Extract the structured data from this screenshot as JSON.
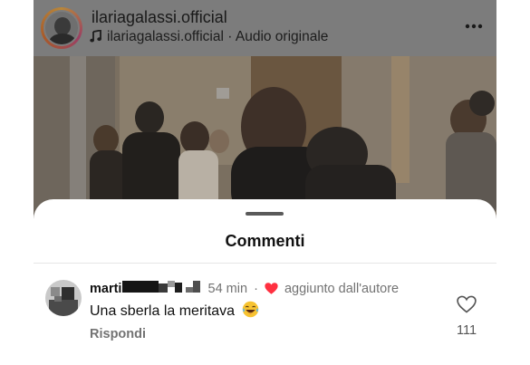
{
  "post": {
    "username": "ilariagalassi.official",
    "audio_text": "ilariagalassi.official · Audio originale",
    "more_icon": "more-horizontal-icon",
    "music_icon": "music-note-icon"
  },
  "comments_sheet": {
    "title": "Commenti",
    "comment": {
      "user": "marti",
      "time": "54 min",
      "separator": "·",
      "author_badge": "aggiunto dall'autore",
      "text": "Una sberla la meritava",
      "emoji": "😂",
      "reply_label": "Rispondi",
      "like_count": "111",
      "heart_color": "#ff3040"
    }
  }
}
